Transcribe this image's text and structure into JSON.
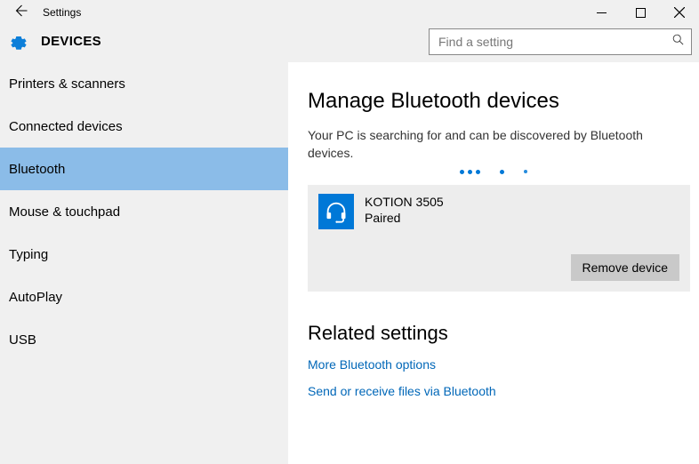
{
  "titlebar": {
    "title": "Settings"
  },
  "header": {
    "category": "DEVICES"
  },
  "search": {
    "placeholder": "Find a setting"
  },
  "sidebar": {
    "items": [
      {
        "label": "Printers & scanners",
        "active": false
      },
      {
        "label": "Connected devices",
        "active": false
      },
      {
        "label": "Bluetooth",
        "active": true
      },
      {
        "label": "Mouse & touchpad",
        "active": false
      },
      {
        "label": "Typing",
        "active": false
      },
      {
        "label": "AutoPlay",
        "active": false
      },
      {
        "label": "USB",
        "active": false
      }
    ]
  },
  "page": {
    "title": "Manage Bluetooth devices",
    "description": "Your PC is searching for and can be discovered by Bluetooth devices."
  },
  "device": {
    "name": "KOTION 3505",
    "status": "Paired",
    "remove_label": "Remove device"
  },
  "related": {
    "heading": "Related settings",
    "links": [
      "More Bluetooth options",
      "Send or receive files via Bluetooth"
    ]
  }
}
